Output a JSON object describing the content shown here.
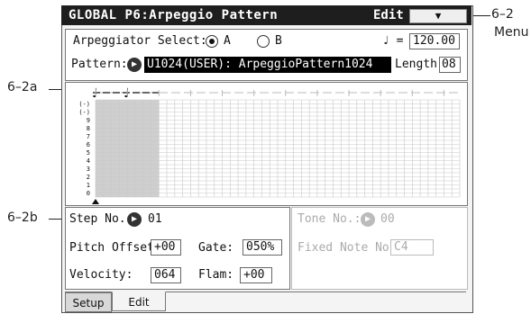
{
  "header": {
    "title": "GLOBAL  P6:Arpeggio Pattern",
    "edit": "Edit",
    "menu_icon": "chevron-down"
  },
  "arp": {
    "select_label": "Arpeggiator Select:",
    "option_a": "A",
    "option_b": "B",
    "selected": "A",
    "tempo_symbol": "♩ =",
    "tempo": "120.00",
    "pattern_label": "Pattern:",
    "pattern_value": "U1024(USER): ArpeggioPattern1024",
    "length_label": "Length:",
    "length_value": "08"
  },
  "grid": {
    "y_labels": [
      "(-)",
      "(-)",
      "9",
      "8",
      "7",
      "6",
      "5",
      "4",
      "3",
      "2",
      "1",
      "0"
    ],
    "steps": 8,
    "columns": 46,
    "rows": 24
  },
  "step": {
    "step_no_label": "Step No.:",
    "step_no_value": "01",
    "pitch_offset_label": "Pitch Offset:",
    "pitch_offset_value": "+00",
    "gate_label": "Gate:",
    "gate_value": "050%",
    "velocity_label": "Velocity:",
    "velocity_value": "064",
    "flam_label": "Flam:",
    "flam_value": "+00"
  },
  "tone": {
    "tone_no_label": "Tone No.:",
    "tone_no_value": "00",
    "fixed_note_label": "Fixed Note No.:",
    "fixed_note_value": "C4"
  },
  "tabs": [
    {
      "label": "Setup",
      "active": false
    },
    {
      "label": "Edit",
      "active": true
    }
  ],
  "annotations": {
    "menu_ref": "6–2",
    "menu_word": "Menu",
    "grid_ref": "6–2a",
    "step_ref": "6–2b"
  }
}
